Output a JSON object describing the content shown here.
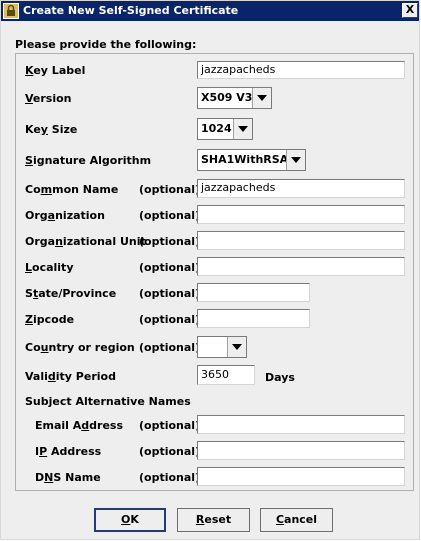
{
  "window": {
    "title": "Create New Self-Signed Certificate",
    "close_glyph": "X"
  },
  "form": {
    "prompt": "Please provide the following:",
    "optional": "(optional)",
    "key_label": {
      "label_pre": "",
      "label_u": "K",
      "label_post": "ey Label",
      "value": "jazzapacheds"
    },
    "version": {
      "label_pre": "",
      "label_u": "V",
      "label_post": "ersion",
      "value": "X509 V3"
    },
    "key_size": {
      "label_pre": "Ke",
      "label_u": "y",
      "label_post": " Size",
      "value": "1024"
    },
    "signature_algorithm": {
      "label_pre": "",
      "label_u": "S",
      "label_post": "ignature Algorithm",
      "value": "SHA1WithRSA"
    },
    "common_name": {
      "label_pre": "Co",
      "label_u": "m",
      "label_post": "mon Name",
      "value": "jazzapacheds"
    },
    "organization": {
      "label_pre": "Org",
      "label_u": "a",
      "label_post": "nization",
      "value": ""
    },
    "organizational_unit": {
      "label_pre": "Orga",
      "label_u": "n",
      "label_post": "izational Unit",
      "value": ""
    },
    "locality": {
      "label_pre": "",
      "label_u": "L",
      "label_post": "ocality",
      "value": ""
    },
    "state": {
      "label_pre": "S",
      "label_u": "t",
      "label_post": "ate/Province",
      "value": ""
    },
    "zipcode": {
      "label_pre": "",
      "label_u": "Z",
      "label_post": "ipcode",
      "value": ""
    },
    "country": {
      "label_pre": "Co",
      "label_u": "u",
      "label_post": "ntry or region",
      "value": ""
    },
    "validity": {
      "label_pre": "Vali",
      "label_u": "d",
      "label_post": "ity Period",
      "value": "3650",
      "unit": "Days"
    },
    "san_heading": "Subject Alternative Names",
    "email": {
      "label_pre": "Email A",
      "label_u": "d",
      "label_post": "dress",
      "value": ""
    },
    "ip": {
      "label_pre": "I",
      "label_u": "P",
      "label_post": " Address",
      "value": ""
    },
    "dns": {
      "label_pre": "D",
      "label_u": "N",
      "label_post": "S Name",
      "value": ""
    }
  },
  "buttons": {
    "ok": {
      "label_u": "O",
      "label_post": "K"
    },
    "reset": {
      "label_u": "R",
      "label_post": "eset"
    },
    "cancel": {
      "label_u": "C",
      "label_post": "ancel"
    }
  }
}
